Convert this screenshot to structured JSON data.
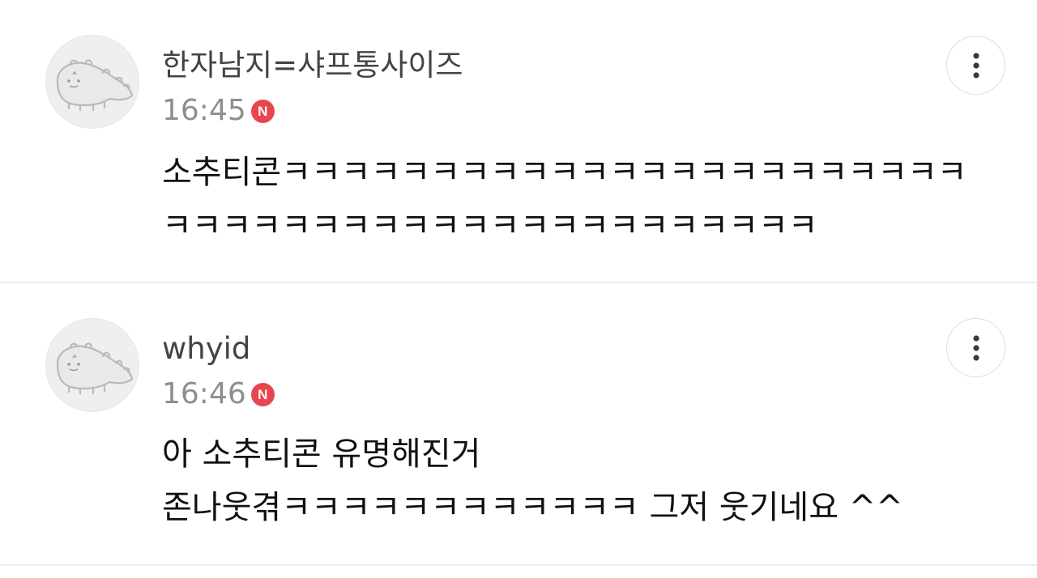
{
  "comments": [
    {
      "nickname": "한자남지=샤프통사이즈",
      "time": "16:45",
      "badge": "N",
      "lines": [
        "소추티콘ㅋㅋㅋㅋㅋㅋㅋㅋㅋㅋㅋㅋㅋㅋㅋㅋㅋㅋㅋㅋㅋㅋㅋ",
        "ㅋㅋㅋㅋㅋㅋㅋㅋㅋㅋㅋㅋㅋㅋㅋㅋㅋㅋㅋㅋㅋㅋ"
      ],
      "more_icon": "more-vertical-icon",
      "avatar_icon": "dinosaur-avatar-icon"
    },
    {
      "nickname": "whyid",
      "time": "16:46",
      "badge": "N",
      "lines": [
        "아 소추티콘 유명해진거",
        "존나웃겪ㅋㅋㅋㅋㅋㅋㅋㅋㅋㅋㅋㅋ 그저 웃기네요 ^^"
      ],
      "more_icon": "more-vertical-icon",
      "avatar_icon": "dinosaur-avatar-icon"
    }
  ],
  "colors": {
    "badge": "#e8454f",
    "nickname": "#444444",
    "time": "#8e8e8e",
    "text": "#111111",
    "divider": "#ececec"
  }
}
